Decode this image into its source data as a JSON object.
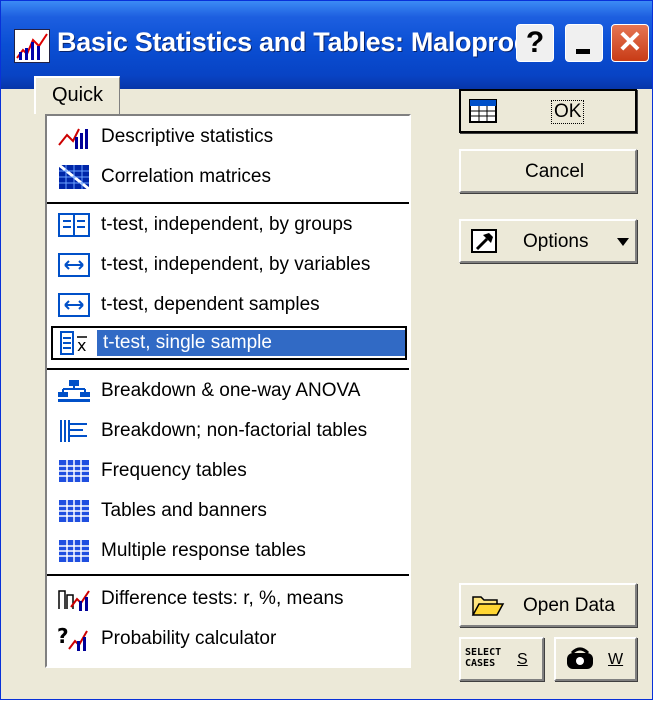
{
  "window": {
    "title": "Basic Statistics and Tables: Maloprod"
  },
  "titlebar": {
    "help": "?",
    "close": "✕"
  },
  "tabs": [
    {
      "label": "Quick"
    }
  ],
  "list": {
    "items": [
      {
        "label": "Descriptive statistics",
        "icon": "descriptive-stats-icon"
      },
      {
        "label": "Correlation matrices",
        "icon": "correlation-matrix-icon"
      },
      {
        "label": "t-test, independent, by groups",
        "icon": "ttest-groups-icon"
      },
      {
        "label": "t-test, independent, by variables",
        "icon": "ttest-variables-icon"
      },
      {
        "label": "t-test, dependent samples",
        "icon": "ttest-dependent-icon"
      },
      {
        "label": "t-test, single sample",
        "icon": "ttest-single-icon",
        "selected": true
      },
      {
        "label": "Breakdown & one-way ANOVA",
        "icon": "breakdown-anova-icon"
      },
      {
        "label": "Breakdown; non-factorial tables",
        "icon": "breakdown-tables-icon"
      },
      {
        "label": "Frequency tables",
        "icon": "frequency-table-icon"
      },
      {
        "label": "Tables and banners",
        "icon": "banner-table-icon"
      },
      {
        "label": "Multiple response tables",
        "icon": "multiple-response-icon"
      },
      {
        "label": "Difference tests: r, %, means",
        "icon": "difference-tests-icon"
      },
      {
        "label": "Probability calculator",
        "icon": "probability-calc-icon"
      }
    ]
  },
  "buttons": {
    "ok": "OK",
    "cancel": "Cancel",
    "options": "Options",
    "open_data": "Open Data",
    "select_cases_icon_text": "SELECT CASES",
    "select_cases_key": "S",
    "weight_key": "W"
  },
  "colors": {
    "selection": "#316ac5",
    "titlebar": "#0a4fd4",
    "face": "#ece9d8"
  }
}
